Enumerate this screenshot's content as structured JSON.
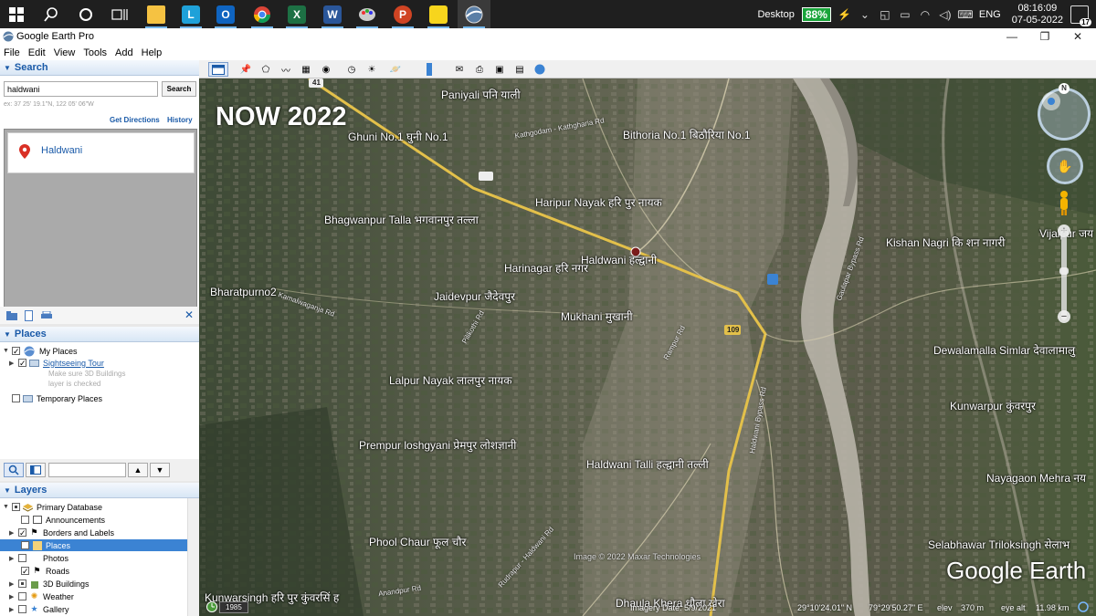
{
  "taskbar": {
    "apps": [
      {
        "name": "start",
        "label": ""
      },
      {
        "name": "search",
        "label": ""
      },
      {
        "name": "cortana",
        "label": ""
      },
      {
        "name": "task-view",
        "label": ""
      },
      {
        "name": "file-explorer",
        "label": ""
      },
      {
        "name": "app-l",
        "label": "L"
      },
      {
        "name": "outlook",
        "label": "O"
      },
      {
        "name": "chrome",
        "label": ""
      },
      {
        "name": "excel",
        "label": "X"
      },
      {
        "name": "word",
        "label": "W"
      },
      {
        "name": "paint",
        "label": ""
      },
      {
        "name": "powerpoint",
        "label": "P"
      },
      {
        "name": "sticky-notes",
        "label": ""
      },
      {
        "name": "google-earth",
        "label": ""
      }
    ],
    "desktop_label": "Desktop",
    "battery": "88%",
    "language": "ENG",
    "time": "08:16:09",
    "date": "07-05-2022",
    "notifications": "17"
  },
  "window": {
    "title": "Google Earth Pro",
    "minimize": "—",
    "maximize": "❐",
    "close": "✕"
  },
  "menu": {
    "file": "File",
    "edit": "Edit",
    "view": "View",
    "tools": "Tools",
    "add": "Add",
    "help": "Help"
  },
  "search": {
    "header": "Search",
    "query": "haldwani",
    "button": "Search",
    "example": "ex: 37 25' 19.1\"N, 122 05' 06\"W",
    "get_directions": "Get Directions",
    "history": "History",
    "result": "Haldwani"
  },
  "places": {
    "header": "Places",
    "my_places": "My Places",
    "sightseeing": "Sightseeing Tour",
    "note_line1": "Make sure 3D Buildings",
    "note_line2": "layer is checked",
    "temporary": "Temporary Places"
  },
  "layers": {
    "header": "Layers",
    "items": [
      {
        "label": "Primary Database"
      },
      {
        "label": "Announcements"
      },
      {
        "label": "Borders and Labels"
      },
      {
        "label": "Places"
      },
      {
        "label": "Photos"
      },
      {
        "label": "Roads"
      },
      {
        "label": "3D Buildings"
      },
      {
        "label": "Weather"
      },
      {
        "label": "Gallery"
      }
    ]
  },
  "map": {
    "overlay_title": "NOW 2022",
    "places": [
      "Paniyali पनि याली",
      "Ghuni No.1 घुनी No.1",
      "Bithoria No.1 बिठौरिया No.1",
      "Haripur Nayak हरि पुर नायक",
      "Bhagwanpur Talla भगवानपुर तल्ला",
      "Haldwani हल्द्वानी",
      "Harinagar हरि नगर",
      "Kishan Nagri कि शन नागरी",
      "Vijaipur जय",
      "Bharatpurno2",
      "Jaidevpur जैदेवपुर",
      "Mukhani मुखानी",
      "Dewalamalla Simlar देवालामालु",
      "Lalpur Nayak लालपुर नायक",
      "Kunwarpur कुंवरपुर",
      "Prempur loshgyani प्रेमपुर लोशज्ञानी",
      "Haldwani Talli हल्द्वानी तल्ली",
      "Nayagaon Mehra नय",
      "Phool Chaur फूल चौर",
      "Selabhawar Triloksingh सेलाभ",
      "Kunwarsingh हरि पुर कुंवरसिं ह",
      "Dhaula Khera धौला खेरा",
      "Anandpur Rd"
    ],
    "roads": [
      "Kathgodam - Kathgharia Rd",
      "Kamalwaganja Rd",
      "Rampur Rd",
      "Haldwani Bypass Rd",
      "Rudrapur - Haldwani Rd",
      "Gaulapar Bypass Rd",
      "Pilikothi Rd",
      "109",
      "41"
    ],
    "copyright": "Image © 2022 Maxar Technologies",
    "logo": "Google Earth",
    "history_year": "1985",
    "imagery_date": "Imagery Date: 5/9/2021",
    "lat": "29°10'24.01\" N",
    "lon": "79°29'50.27\" E",
    "elev_label": "elev",
    "elev": "370 m",
    "eye_label": "eye alt",
    "eye_alt": "11.98 km",
    "nav_north": "N"
  },
  "colors": {
    "taskbar": "#1f1f1f",
    "panel_header_text": "#1a5aa8",
    "link": "#1a5aa8",
    "battery": "#1aa53b",
    "road": "#e3c04a"
  }
}
